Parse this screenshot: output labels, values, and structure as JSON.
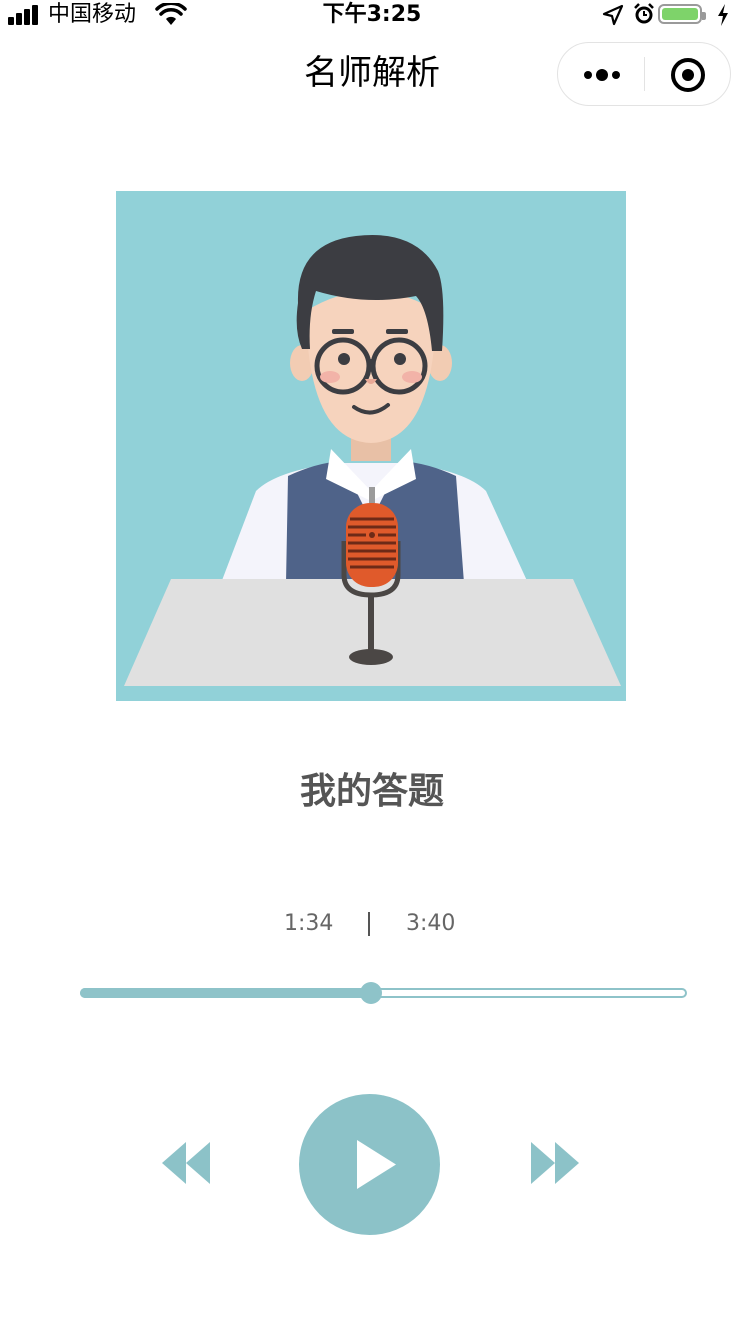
{
  "status_bar": {
    "carrier": "中国移动",
    "time": "下午3:25",
    "battery_level": 0.9,
    "icons": [
      "signal-icon",
      "wifi-icon",
      "location-icon",
      "alarm-icon",
      "battery-icon",
      "charging-bolt-icon"
    ]
  },
  "nav": {
    "title": "名师解析",
    "menu_icon": "more-dots-icon",
    "close_icon": "target-circle-icon"
  },
  "cover": {
    "icon": "teacher-with-microphone-illustration",
    "colors": {
      "background": "#91d1d8",
      "mic": "#e05a2b",
      "vest": "#4f6389"
    }
  },
  "player": {
    "title": "我的答题",
    "current_time": "1:34",
    "total_time": "3:40",
    "progress": 0.48,
    "accent_color": "#8cc2c8",
    "controls": [
      "rewind-icon",
      "play-icon",
      "fast-forward-icon"
    ]
  }
}
